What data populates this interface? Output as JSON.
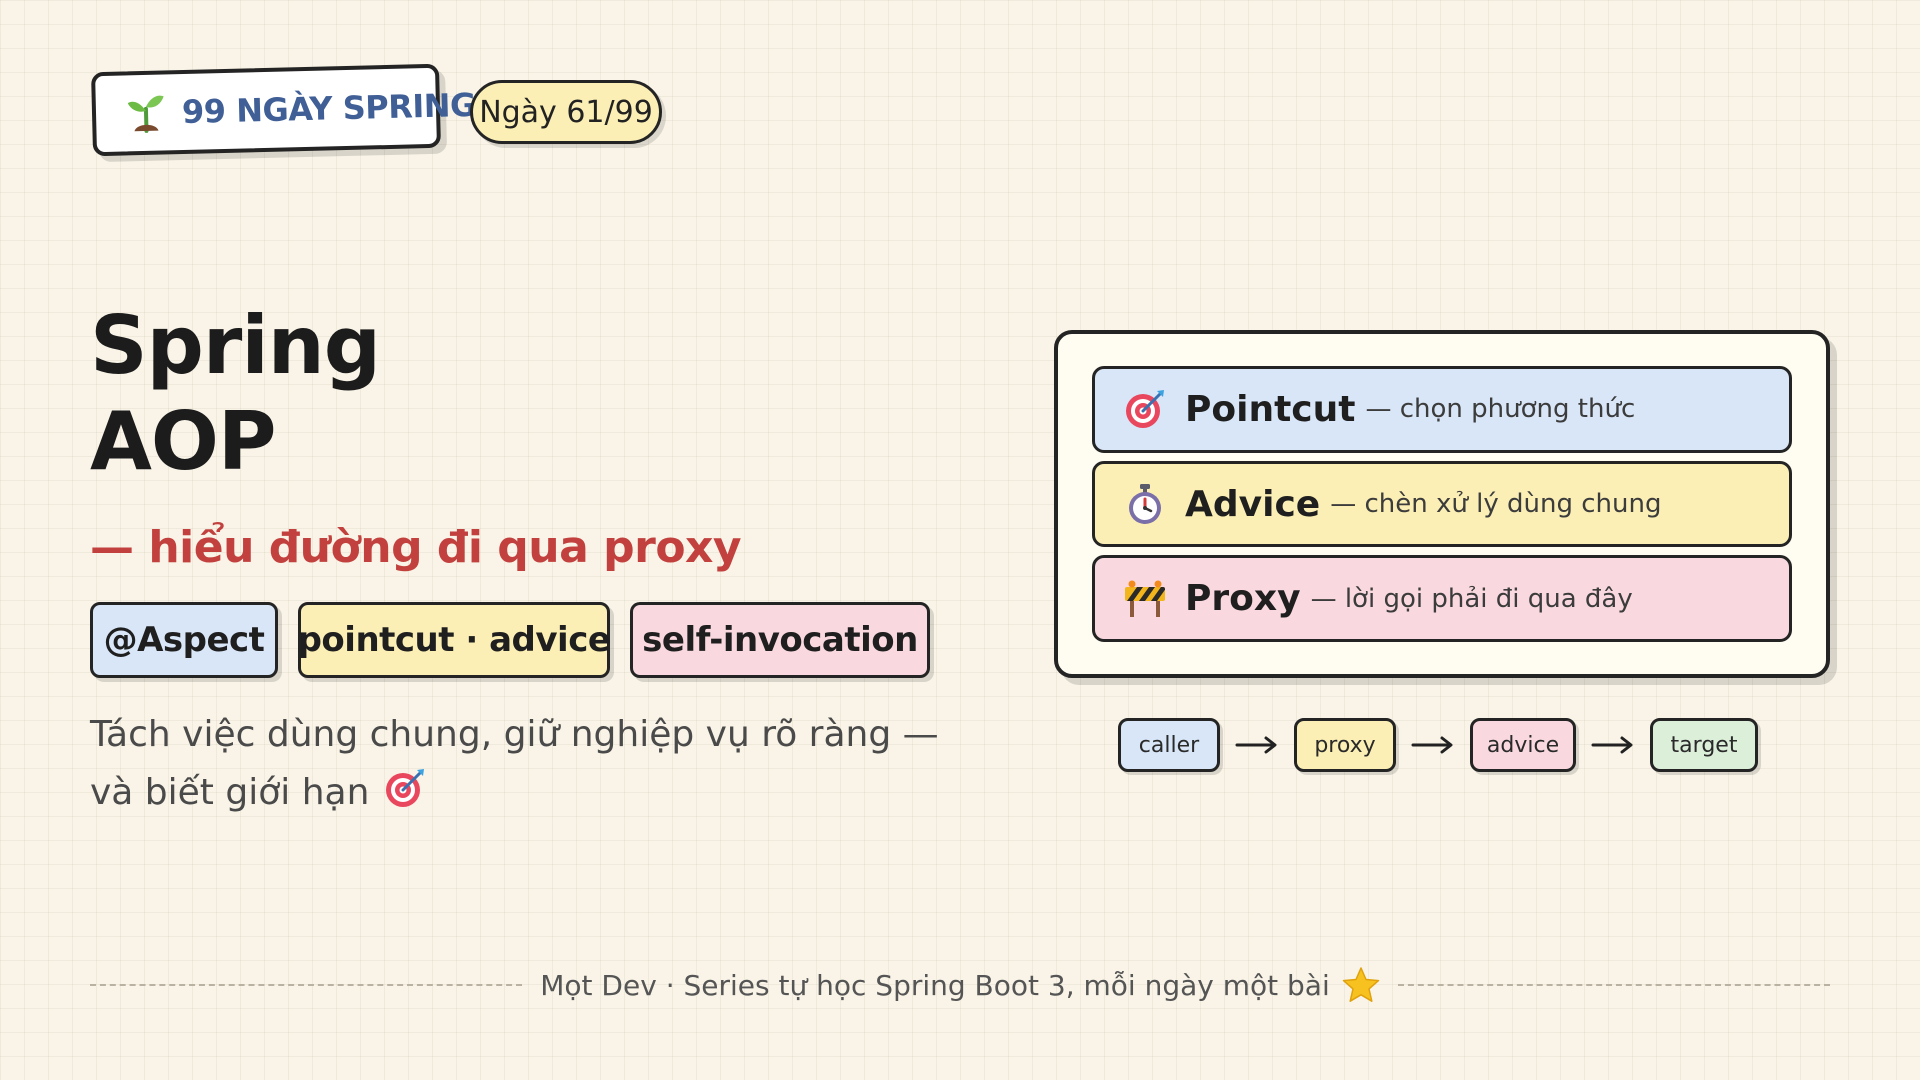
{
  "header": {
    "series_label": "99 NGÀY SPRING",
    "series_icon": "sprout-icon",
    "day_label": "Ngày 61/99"
  },
  "hero": {
    "title_line1": "Spring",
    "title_line2": "AOP",
    "subtitle": "— hiểu đường đi qua proxy",
    "tags": [
      {
        "label": "@Aspect",
        "color": "#d8e6f8"
      },
      {
        "label": "pointcut · advice",
        "color": "#fbefb5"
      },
      {
        "label": "self-invocation",
        "color": "#f9d9df"
      }
    ],
    "description": "Tách việc dùng chung, giữ nghiệp vụ rõ ràng — và biết giới hạn",
    "description_icon": "target-icon"
  },
  "concepts": [
    {
      "term": "Pointcut",
      "desc": "— chọn phương thức",
      "icon": "target-icon",
      "color": "#d8e6f8"
    },
    {
      "term": "Advice",
      "desc": "— chèn xử lý dùng chung",
      "icon": "stopwatch-icon",
      "color": "#fbefb5"
    },
    {
      "term": "Proxy",
      "desc": "— lời gọi phải đi qua đây",
      "icon": "barrier-icon",
      "color": "#f9d9df"
    }
  ],
  "flow": [
    {
      "label": "caller",
      "color": "#d8e6f8"
    },
    {
      "label": "proxy",
      "color": "#fbefb5"
    },
    {
      "label": "advice",
      "color": "#f9d9df"
    },
    {
      "label": "target",
      "color": "#dcefd9"
    }
  ],
  "footer": {
    "text": "Mọt Dev · Series tự học Spring Boot 3, mỗi ngày một bài",
    "icon": "star-icon"
  },
  "colors": {
    "background": "#f9f4e7",
    "accent_red": "#c2413e",
    "series_blue": "#3f5f96",
    "outline": "#242424"
  }
}
